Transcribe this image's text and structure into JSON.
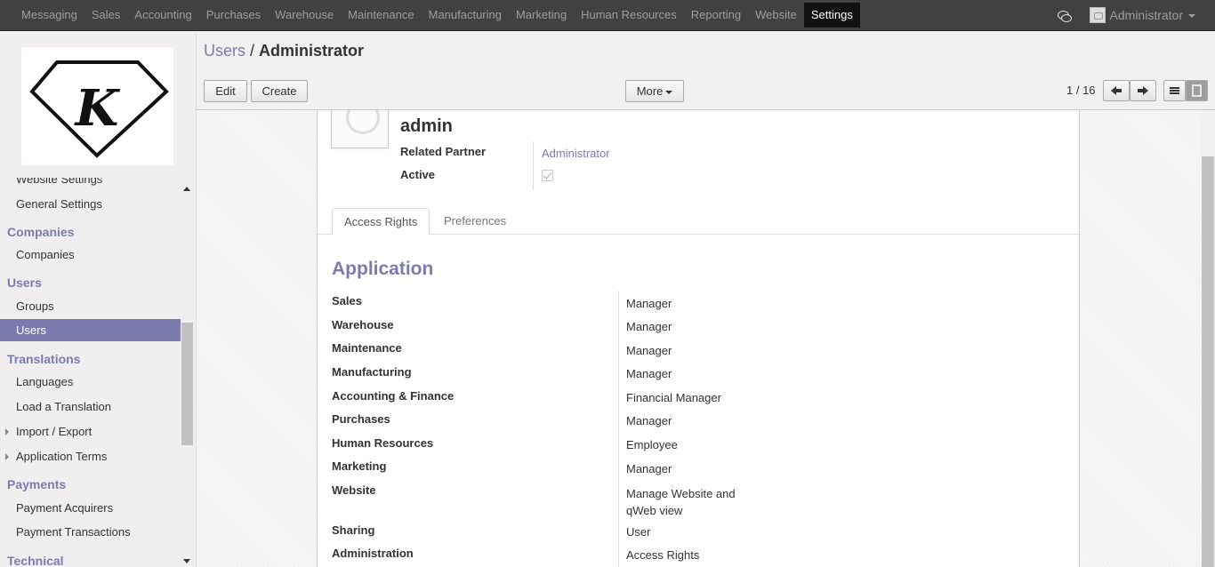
{
  "topmenu": [
    "Messaging",
    "Sales",
    "Accounting",
    "Purchases",
    "Warehouse",
    "Maintenance",
    "Manufacturing",
    "Marketing",
    "Human Resources",
    "Reporting",
    "Website",
    "Settings"
  ],
  "active_menu": "Settings",
  "user": {
    "name": "Administrator"
  },
  "sidebar": {
    "partial_item": "Website Settings",
    "general_settings": "General Settings",
    "companies_head": "Companies",
    "companies": "Companies",
    "users_head": "Users",
    "groups": "Groups",
    "users": "Users",
    "translations_head": "Translations",
    "languages": "Languages",
    "load_translation": "Load a Translation",
    "import_export": "Import / Export",
    "app_terms": "Application Terms",
    "payments_head": "Payments",
    "payment_acquirers": "Payment Acquirers",
    "payment_transactions": "Payment Transactions",
    "technical_head": "Technical"
  },
  "breadcrumb": {
    "parent": "Users",
    "sep": " / ",
    "current": "Administrator"
  },
  "buttons": {
    "edit": "Edit",
    "create": "Create",
    "more": "More"
  },
  "pager": "1 / 16",
  "form": {
    "name": "admin",
    "related_partner_label": "Related Partner",
    "related_partner_value": "Administrator",
    "active_label": "Active",
    "active_checked": true,
    "tabs": [
      "Access Rights",
      "Preferences"
    ],
    "section": "Application",
    "rights": [
      {
        "label": "Sales",
        "value": "Manager"
      },
      {
        "label": "Warehouse",
        "value": "Manager"
      },
      {
        "label": "Maintenance",
        "value": "Manager"
      },
      {
        "label": "Manufacturing",
        "value": "Manager"
      },
      {
        "label": "Accounting & Finance",
        "value": "Financial Manager"
      },
      {
        "label": "Purchases",
        "value": "Manager"
      },
      {
        "label": "Human Resources",
        "value": "Employee"
      },
      {
        "label": "Marketing",
        "value": "Manager"
      },
      {
        "label": "Website",
        "value": "Manage Website and qWeb view"
      },
      {
        "label": "Sharing",
        "value": "User"
      },
      {
        "label": "Administration",
        "value": "Access Rights"
      }
    ]
  },
  "colors": {
    "accent": "#7c7bad",
    "topbar": "#414141"
  }
}
